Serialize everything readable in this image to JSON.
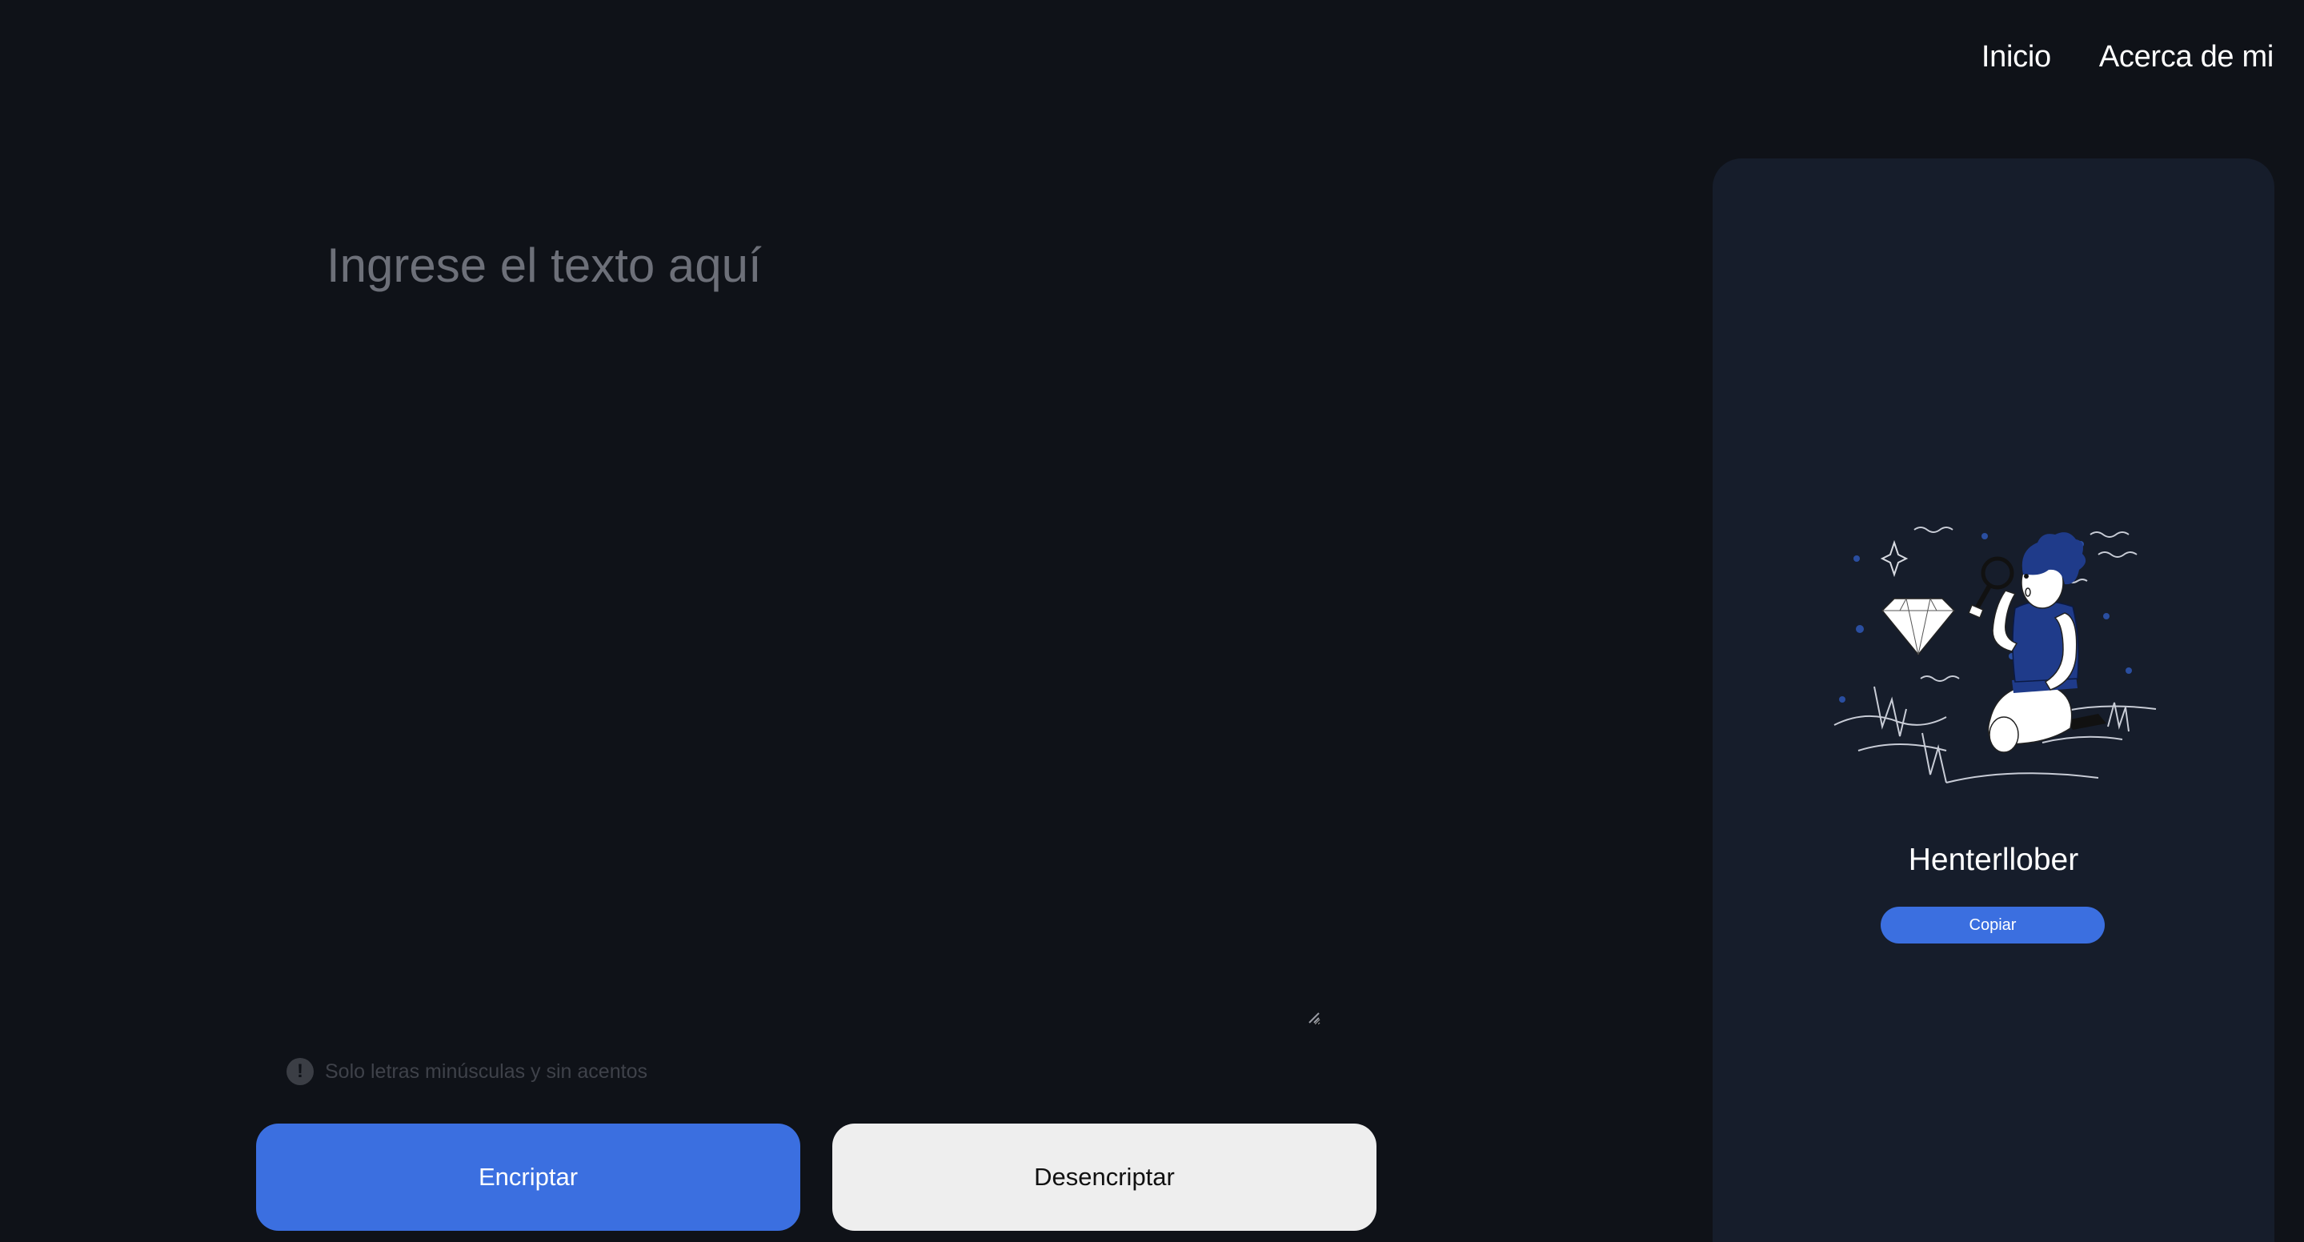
{
  "nav": {
    "items": [
      {
        "label": "Inicio"
      },
      {
        "label": "Acerca de mi"
      }
    ]
  },
  "input": {
    "placeholder": "Ingrese el texto aquí",
    "value": ""
  },
  "hint": {
    "icon": "exclamation-circle-icon",
    "text": "Solo letras minúsculas y sin acentos"
  },
  "actions": {
    "encrypt_label": "Encriptar",
    "decrypt_label": "Desencriptar"
  },
  "output": {
    "illustration": "searching-person-with-magnifier-illustration",
    "text": "Henterllober",
    "copy_label": "Copiar"
  },
  "colors": {
    "background": "#0f1218",
    "panel": "#161d2b",
    "accent": "#3b6fe0",
    "secondary_button": "#eeeeee"
  }
}
